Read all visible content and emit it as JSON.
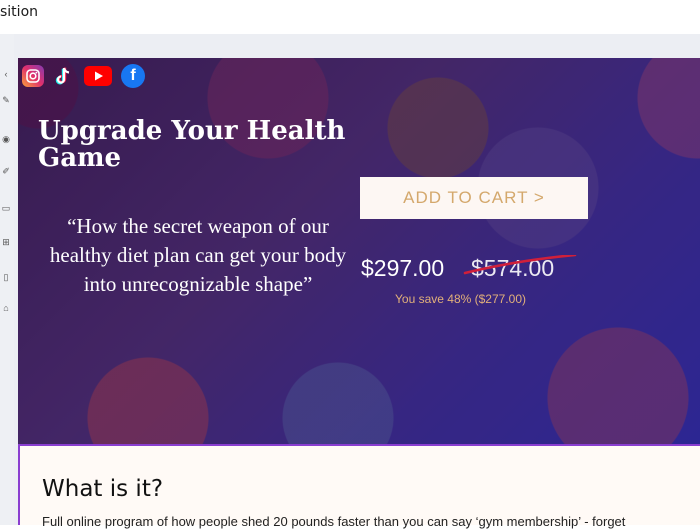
{
  "window": {
    "title_fragment": "sition"
  },
  "left_rail": {
    "icons": [
      "chevron-icon",
      "pen-icon",
      "eye-icon",
      "brush-icon",
      "file-icon",
      "grid-icon",
      "page-icon",
      "tag-icon"
    ]
  },
  "social": [
    {
      "name": "instagram-icon",
      "color": "#e1306c"
    },
    {
      "name": "tiktok-icon",
      "color": "#000000"
    },
    {
      "name": "youtube-icon",
      "color": "#ff0000"
    },
    {
      "name": "facebook-icon",
      "color": "#1877f2"
    }
  ],
  "hero": {
    "headline": "Upgrade Your Health Game",
    "quote": "“How the secret weapon of our healthy diet plan can get your body into unrecognizable shape”",
    "cart_button": "ADD TO CART >",
    "price_new": "$297.00",
    "price_old": "$574.00",
    "savings": "You save 48% ($277.00)"
  },
  "section": {
    "title": "What is it?",
    "body": "Full online program of how people shed 20 pounds faster than you can say ‘gym membership’ - forget"
  },
  "colors": {
    "accent_border": "#8a3ed0",
    "button_text": "#d4a86c",
    "strike": "#d01f3a",
    "savings_text": "#e2b07a"
  }
}
